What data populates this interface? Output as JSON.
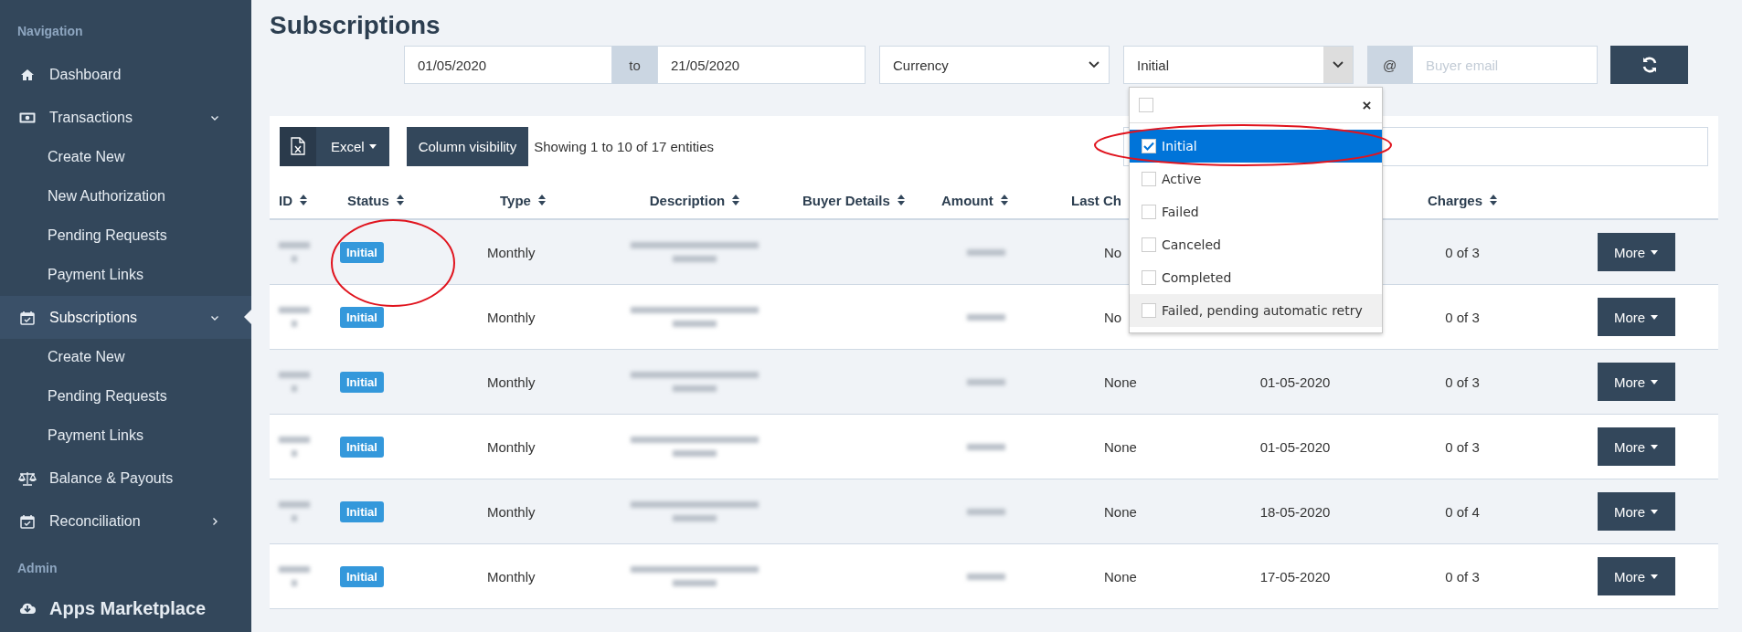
{
  "sidebar": {
    "sections": [
      {
        "heading": "Navigation",
        "items": [
          {
            "label": "Dashboard",
            "kind": "link",
            "selected": false
          },
          {
            "label": "Transactions",
            "kind": "link",
            "selected": false,
            "expanded": true,
            "children": [
              {
                "label": "Create New"
              },
              {
                "label": "New Authorization"
              },
              {
                "label": "Pending Requests"
              },
              {
                "label": "Payment Links"
              }
            ]
          },
          {
            "label": "Subscriptions",
            "kind": "link",
            "selected": true,
            "expanded": true,
            "children": [
              {
                "label": "Create New"
              },
              {
                "label": "Pending Requests"
              },
              {
                "label": "Payment Links"
              }
            ]
          },
          {
            "label": "Balance & Payouts",
            "kind": "link",
            "selected": false
          },
          {
            "label": "Reconciliation",
            "kind": "link",
            "selected": false,
            "expanded": false
          }
        ]
      },
      {
        "heading": "Admin",
        "items": [
          {
            "label": "Apps Marketplace",
            "kind": "prominent",
            "selected": false
          }
        ]
      }
    ]
  },
  "page": {
    "title": "Subscriptions"
  },
  "filters": {
    "date_from": "01/05/2020",
    "range_separator": "to",
    "date_to": "21/05/2020",
    "currency": {
      "value": "Currency",
      "open": false
    },
    "status": {
      "value": "Initial",
      "open": true
    },
    "email_prefix": "@",
    "email_placeholder": "Buyer email"
  },
  "toolbar": {
    "excel": "Excel",
    "column_visibility": "Column visibility",
    "info": "Showing 1 to 10 of 17 entities"
  },
  "status_dropdown": {
    "select_all_checked": false,
    "options": [
      {
        "label": "Initial",
        "checked": true,
        "selected": true,
        "hovered": false
      },
      {
        "label": "Active",
        "checked": false,
        "selected": false,
        "hovered": false
      },
      {
        "label": "Failed",
        "checked": false,
        "selected": false,
        "hovered": false
      },
      {
        "label": "Canceled",
        "checked": false,
        "selected": false,
        "hovered": false
      },
      {
        "label": "Completed",
        "checked": false,
        "selected": false,
        "hovered": false
      },
      {
        "label": "Failed, pending automatic retry",
        "checked": false,
        "selected": false,
        "hovered": true
      }
    ]
  },
  "table": {
    "columns": [
      {
        "label": "ID",
        "sort_icon": true
      },
      {
        "label": "Status",
        "sort_icon": true
      },
      {
        "label": "Type",
        "sort_icon": true
      },
      {
        "label": "Description",
        "sort_icon": true
      },
      {
        "label": "Buyer Details",
        "sort_icon": true
      },
      {
        "label": "Amount",
        "sort_icon": true
      },
      {
        "label": "Last Ch",
        "sort_icon": false
      },
      {
        "label": "Charges",
        "sort_icon": true
      }
    ],
    "rows": [
      {
        "status": "Initial",
        "type": "Monthly",
        "last_charge": "No",
        "charges": "0 of 3",
        "action": "More"
      },
      {
        "status": "Initial",
        "type": "Monthly",
        "last_charge": "No",
        "charges": "0 of 3",
        "action": "More"
      },
      {
        "status": "Initial",
        "type": "Monthly",
        "last_charge": "None",
        "next_charge": "01-05-2020",
        "charges": "0 of 3",
        "action": "More"
      },
      {
        "status": "Initial",
        "type": "Monthly",
        "last_charge": "None",
        "next_charge": "01-05-2020",
        "charges": "0 of 3",
        "action": "More"
      },
      {
        "status": "Initial",
        "type": "Monthly",
        "last_charge": "None",
        "next_charge": "18-05-2020",
        "charges": "0 of 4",
        "action": "More"
      },
      {
        "status": "Initial",
        "type": "Monthly",
        "last_charge": "None",
        "next_charge": "17-05-2020",
        "charges": "0 of 3",
        "action": "More"
      }
    ]
  }
}
